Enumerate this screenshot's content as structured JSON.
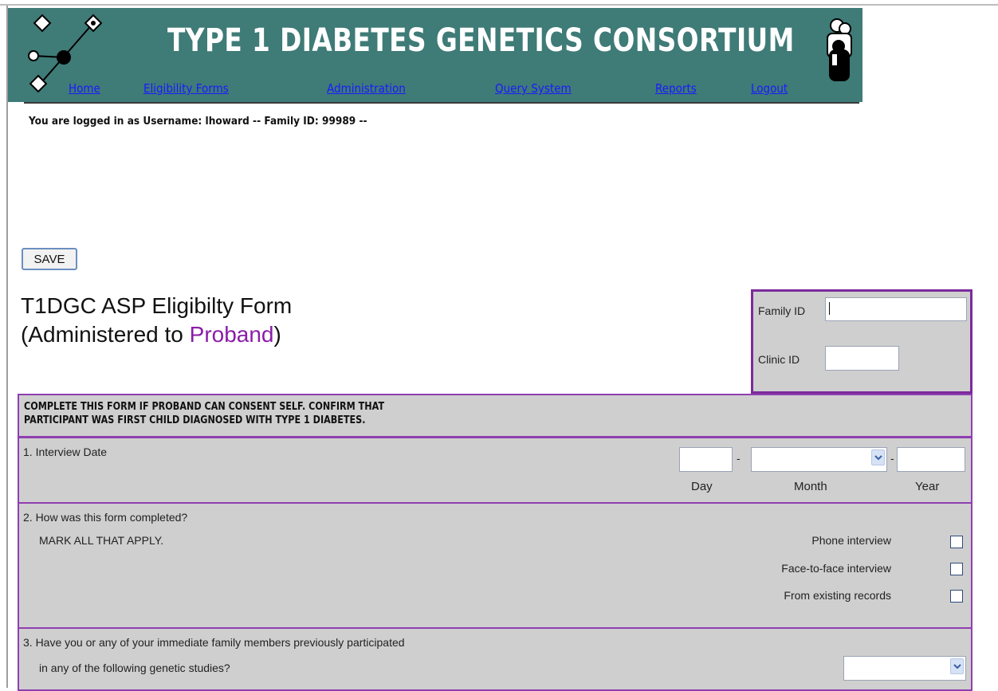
{
  "header": {
    "title": "TYPE 1 DIABETES GENETICS CONSORTIUM",
    "nav": {
      "home": "Home",
      "eligibility_forms": "Eligibility Forms",
      "administration": "Administration",
      "query_system": "Query System",
      "reports": "Reports",
      "logout": "Logout"
    }
  },
  "session": {
    "prefix": "You are logged in as Username:",
    "username": "lhoward",
    "family_label": "--  Family ID:",
    "family_id": "99989",
    "suffix": "--"
  },
  "toolbar": {
    "save_label": "SAVE"
  },
  "form": {
    "title_line1": "T1DGC ASP Eligibilty Form",
    "title_line2_prefix": "(Administered to ",
    "title_line2_accent": "Proband",
    "title_line2_suffix": ")"
  },
  "id_box": {
    "family_id_label": "Family ID",
    "family_id_value": "",
    "clinic_id_label": "Clinic ID",
    "clinic_id_value": ""
  },
  "notice": {
    "line1": "COMPLETE THIS FORM IF PROBAND CAN CONSENT SELF. CONFIRM THAT",
    "line2": "PARTICIPANT WAS FIRST CHILD DIAGNOSED WITH TYPE 1 DIABETES."
  },
  "q1": {
    "label": "1. Interview Date",
    "day_label": "Day",
    "month_label": "Month",
    "year_label": "Year",
    "day_value": "",
    "month_value": "",
    "year_value": "",
    "separator": "-"
  },
  "q2": {
    "label": "2. How was this form completed?",
    "instruction": "MARK ALL THAT APPLY.",
    "options": [
      {
        "label": "Phone interview",
        "checked": false
      },
      {
        "label": "Face-to-face interview",
        "checked": false
      },
      {
        "label": "From existing records",
        "checked": false
      }
    ]
  },
  "q3": {
    "line1": "3. Have you or any of your immediate family members previously participated",
    "line2": "in any of the following genetic studies?",
    "value": ""
  },
  "colors": {
    "banner": "#3f7b77",
    "nav_link": "#1a1aff",
    "accent_purple": "#8a1ca8",
    "section_bg": "#cfcfcf"
  }
}
